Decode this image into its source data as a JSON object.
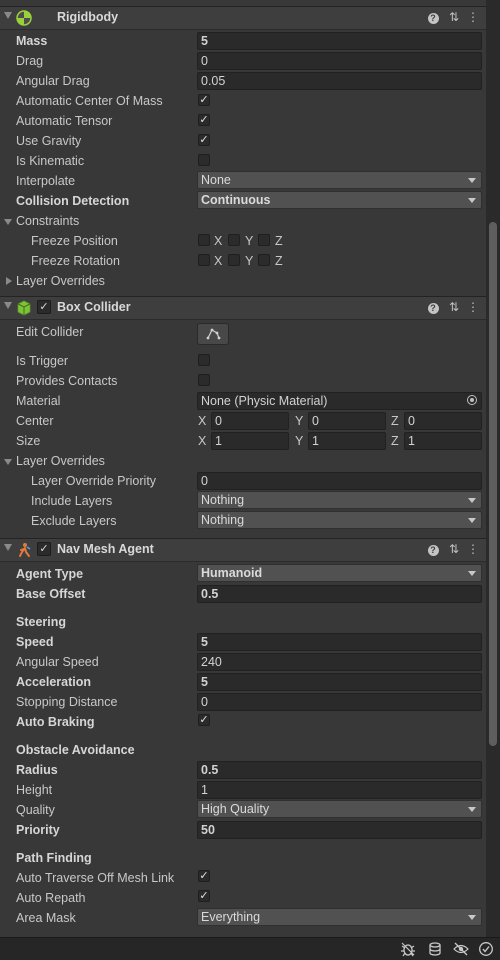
{
  "rigidbody": {
    "title": "Rigidbody",
    "mass_label": "Mass",
    "mass": "5",
    "drag_label": "Drag",
    "drag": "0",
    "angular_drag_label": "Angular Drag",
    "angular_drag": "0.05",
    "auto_com_label": "Automatic Center Of Mass",
    "auto_com": true,
    "auto_tensor_label": "Automatic Tensor",
    "auto_tensor": true,
    "use_gravity_label": "Use Gravity",
    "use_gravity": true,
    "is_kinematic_label": "Is Kinematic",
    "is_kinematic": false,
    "interpolate_label": "Interpolate",
    "interpolate": "None",
    "collision_label": "Collision Detection",
    "collision": "Continuous",
    "constraints_label": "Constraints",
    "freeze_position_label": "Freeze Position",
    "freeze_rotation_label": "Freeze Rotation",
    "axis_x": "X",
    "axis_y": "Y",
    "axis_z": "Z",
    "layer_overrides_label": "Layer Overrides"
  },
  "box_collider": {
    "title": "Box Collider",
    "edit_collider_label": "Edit Collider",
    "is_trigger_label": "Is Trigger",
    "provides_contacts_label": "Provides Contacts",
    "material_label": "Material",
    "material": "None (Physic Material)",
    "center_label": "Center",
    "center": {
      "x": "0",
      "y": "0",
      "z": "0"
    },
    "size_label": "Size",
    "size": {
      "x": "1",
      "y": "1",
      "z": "1"
    },
    "layer_overrides_label": "Layer Overrides",
    "priority_label": "Layer Override Priority",
    "priority": "0",
    "include_label": "Include Layers",
    "include": "Nothing",
    "exclude_label": "Exclude Layers",
    "exclude": "Nothing"
  },
  "nav_mesh_agent": {
    "title": "Nav Mesh Agent",
    "agent_type_label": "Agent Type",
    "agent_type": "Humanoid",
    "base_offset_label": "Base Offset",
    "base_offset": "0.5",
    "steering_label": "Steering",
    "speed_label": "Speed",
    "speed": "5",
    "angular_speed_label": "Angular Speed",
    "angular_speed": "240",
    "acceleration_label": "Acceleration",
    "acceleration": "5",
    "stopping_label": "Stopping Distance",
    "stopping": "0",
    "auto_braking_label": "Auto Braking",
    "obstacle_label": "Obstacle Avoidance",
    "radius_label": "Radius",
    "radius": "0.5",
    "height_label": "Height",
    "height": "1",
    "quality_label": "Quality",
    "quality": "High Quality",
    "priority_label": "Priority",
    "priority": "50",
    "path_label": "Path Finding",
    "auto_traverse_label": "Auto Traverse Off Mesh Link",
    "auto_repath_label": "Auto Repath",
    "area_mask_label": "Area Mask",
    "area_mask": "Everything"
  },
  "glyphs": {
    "check": "✓",
    "help": "?",
    "settings": "⇅",
    "more": "⋮"
  },
  "icons": [
    "rigidbody-icon",
    "box-collider-icon",
    "nav-mesh-agent-icon",
    "debug-icon",
    "layers-icon",
    "visibility-icon",
    "checkmark-icon"
  ]
}
